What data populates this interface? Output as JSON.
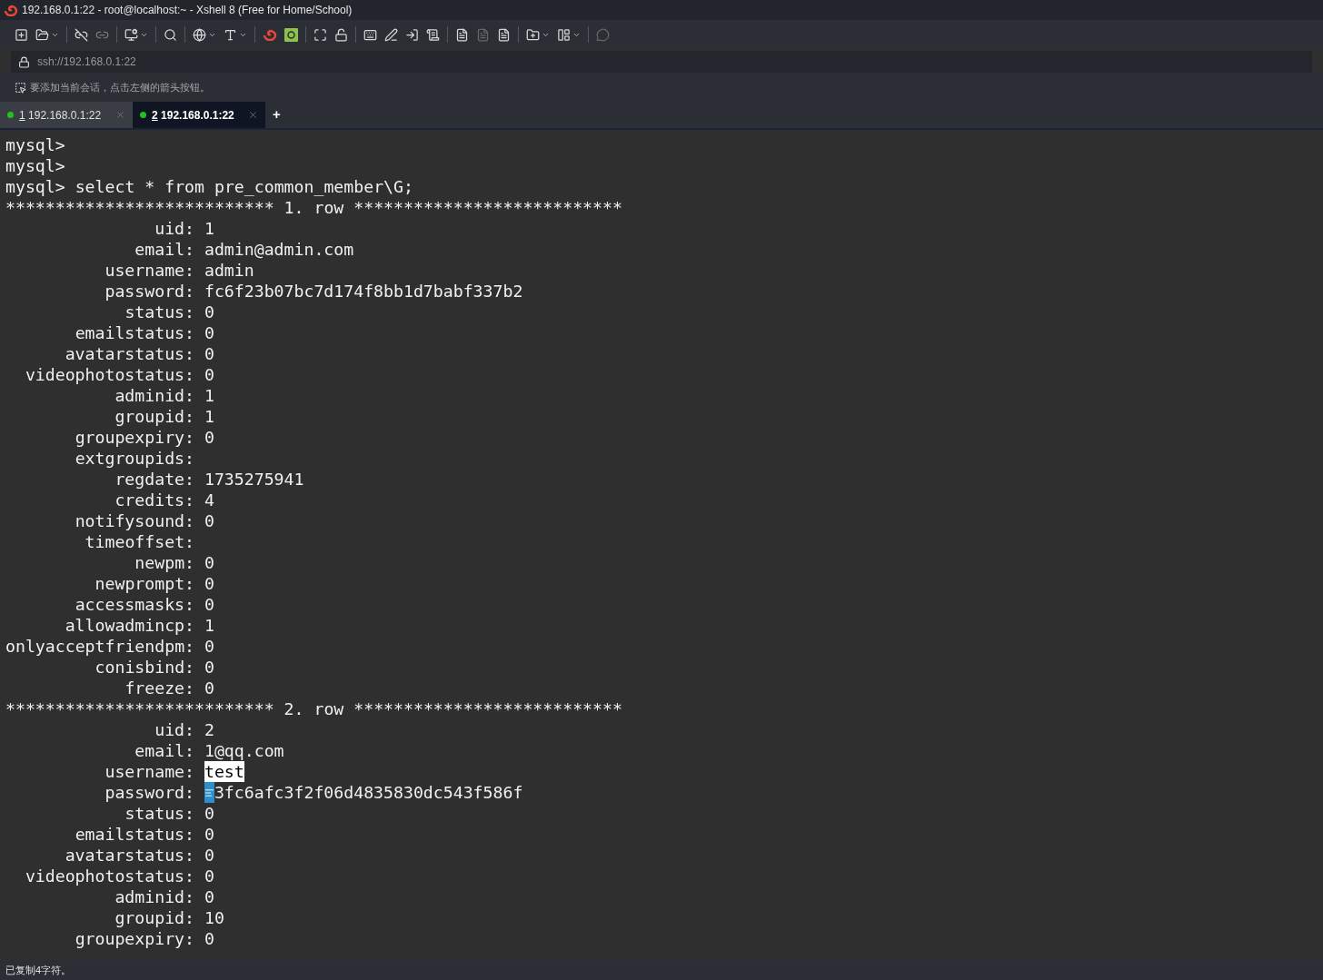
{
  "window": {
    "title": "192.168.0.1:22 - root@localhost:~ - Xshell 8 (Free for Home/School)"
  },
  "address_bar": {
    "value": "ssh://192.168.0.1:22"
  },
  "hint_bar": {
    "text": "要添加当前会话，点击左侧的箭头按钮。"
  },
  "tabs": [
    {
      "number": "1",
      "label": "192.168.0.1:22",
      "selected": false,
      "color": "#1ec31e"
    },
    {
      "number": "2",
      "label": "192.168.0.1:22",
      "selected": true,
      "color": "#1ec31e"
    }
  ],
  "new_tab": "+",
  "terminal": {
    "lines": [
      {
        "kind": "prompt",
        "text": "mysql>"
      },
      {
        "kind": "prompt",
        "text": "mysql>"
      },
      {
        "kind": "prompt",
        "text": "mysql> select * from pre_common_member\\G;"
      },
      {
        "kind": "separator",
        "text": "*************************** 1. row ***************************"
      },
      {
        "kind": "field",
        "label": "uid:",
        "value": "1",
        "selected": false
      },
      {
        "kind": "field",
        "label": "email:",
        "value": "admin@admin.com",
        "selected": false
      },
      {
        "kind": "field",
        "label": "username:",
        "value": "admin",
        "selected": false
      },
      {
        "kind": "field",
        "label": "password:",
        "value": "fc6f23b07bc7d174f8bb1d7babf337b2",
        "selected": false
      },
      {
        "kind": "field",
        "label": "status:",
        "value": "0",
        "selected": false
      },
      {
        "kind": "field",
        "label": "emailstatus:",
        "value": "0",
        "selected": false
      },
      {
        "kind": "field",
        "label": "avatarstatus:",
        "value": "0",
        "selected": false
      },
      {
        "kind": "field",
        "label": "videophotostatus:",
        "value": "0",
        "selected": false
      },
      {
        "kind": "field",
        "label": "adminid:",
        "value": "1",
        "selected": false
      },
      {
        "kind": "field",
        "label": "groupid:",
        "value": "1",
        "selected": false
      },
      {
        "kind": "field",
        "label": "groupexpiry:",
        "value": "0",
        "selected": false
      },
      {
        "kind": "field",
        "label": "extgroupids:",
        "selected": false
      },
      {
        "kind": "field",
        "label": "regdate:",
        "value": "1735275941",
        "selected": false
      },
      {
        "kind": "field",
        "label": "credits:",
        "value": "4",
        "selected": false
      },
      {
        "kind": "field",
        "label": "notifysound:",
        "value": "0",
        "selected": false
      },
      {
        "kind": "field",
        "label": "timeoffset:",
        "selected": false
      },
      {
        "kind": "field",
        "label": "newpm:",
        "value": "0",
        "selected": false
      },
      {
        "kind": "field",
        "label": "newprompt:",
        "value": "0",
        "selected": false
      },
      {
        "kind": "field",
        "label": "accessmasks:",
        "value": "0",
        "selected": false
      },
      {
        "kind": "field",
        "label": "allowadmincp:",
        "value": "1",
        "selected": false
      },
      {
        "kind": "field",
        "label": "onlyacceptfriendpm:",
        "value": "0",
        "selected": false
      },
      {
        "kind": "field",
        "label": "conisbind:",
        "value": "0",
        "selected": false
      },
      {
        "kind": "field",
        "label": "freeze:",
        "value": "0",
        "selected": false
      },
      {
        "kind": "separator",
        "text": "*************************** 2. row ***************************"
      },
      {
        "kind": "field",
        "label": "uid:",
        "value": "2",
        "selected": false
      },
      {
        "kind": "field",
        "label": "email:",
        "value": "1@qq.com",
        "selected": false
      },
      {
        "kind": "field",
        "label": "username:",
        "value": "test",
        "selected": true
      },
      {
        "kind": "field_with_icon",
        "label": "password:",
        "value": "3fc6afc3f2f06d4835830dc543f586f",
        "selected": false
      },
      {
        "kind": "field",
        "label": "status:",
        "value": "0",
        "selected": false
      },
      {
        "kind": "field",
        "label": "emailstatus:",
        "value": "0",
        "selected": false
      },
      {
        "kind": "field",
        "label": "avatarstatus:",
        "value": "0",
        "selected": false
      },
      {
        "kind": "field",
        "label": "videophotostatus:",
        "value": "0",
        "selected": false
      },
      {
        "kind": "field",
        "label": "adminid:",
        "value": "0",
        "selected": false
      },
      {
        "kind": "field",
        "label": "groupid:",
        "value": "10",
        "selected": false
      },
      {
        "kind": "field",
        "label": "groupexpiry:",
        "value": "0",
        "selected": false
      }
    ]
  },
  "status_bar": {
    "text": "已复制4字符。"
  }
}
